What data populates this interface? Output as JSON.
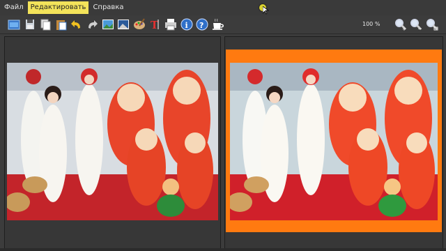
{
  "menu": {
    "items": [
      {
        "label": "Файл"
      },
      {
        "label": "Редактировать"
      },
      {
        "label": "Справка"
      }
    ]
  },
  "toolbar": {
    "icons": [
      "open-icon",
      "save-icon",
      "copy-icon",
      "paste-icon",
      "undo-icon",
      "redo-icon",
      "image-icon",
      "landscape-icon",
      "palette-icon",
      "text-icon",
      "print-icon",
      "info-icon",
      "help-icon",
      "coffee-icon",
      "zoom-in-icon",
      "zoom-out-icon",
      "zoom-fit-icon"
    ],
    "zoom_label": "100 %"
  },
  "colors": {
    "accent_menu": "#f3e35a",
    "frame_orange": "#ff7a10",
    "background": "#3c3c3c"
  }
}
